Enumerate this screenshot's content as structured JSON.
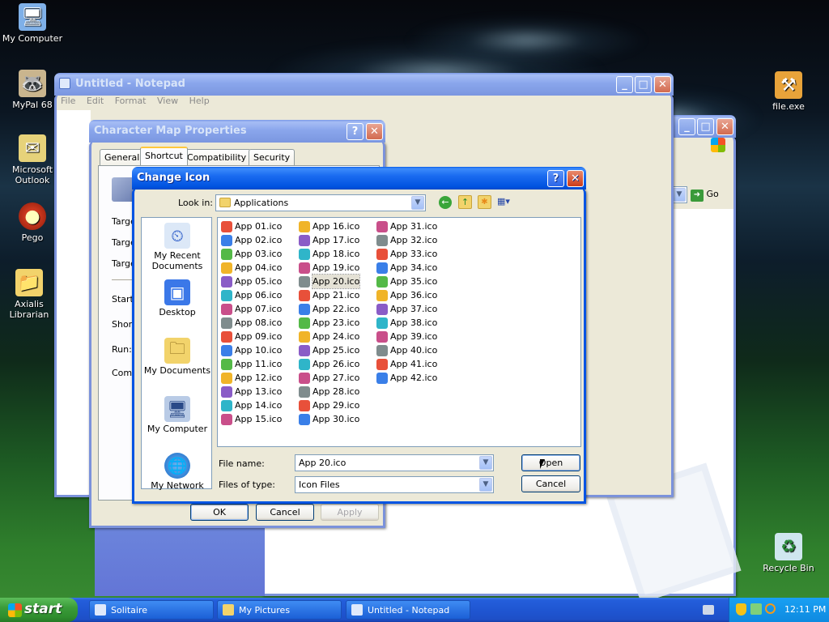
{
  "desktop": {
    "icons": [
      {
        "label": "My Computer",
        "glyph": "🖥"
      },
      {
        "label": "MyPal 68",
        "glyph": "🦝"
      },
      {
        "label": "Microsoft Outlook",
        "glyph": "✉"
      },
      {
        "label": "Pego",
        "glyph": "●"
      },
      {
        "label": "Axialis Librarian",
        "glyph": "📁"
      },
      {
        "label": "file.exe",
        "glyph": "⚒"
      },
      {
        "label": "Recycle Bin",
        "glyph": "♻"
      }
    ]
  },
  "notepad": {
    "title": "Untitled - Notepad",
    "menu": [
      "File",
      "Edit",
      "Format",
      "View",
      "Help"
    ]
  },
  "explorer": {
    "go_label": "Go"
  },
  "charmap": {
    "title": "Character Map Properties",
    "help": "?",
    "tabs": [
      "General",
      "Shortcut",
      "Compatibility",
      "Security"
    ],
    "fields": [
      "Target",
      "Target",
      "Target",
      "Start in",
      "Shortcut",
      "Run:",
      "Comment"
    ],
    "ok": "OK",
    "cancel": "Cancel",
    "apply": "Apply"
  },
  "dialog": {
    "title": "Change Icon",
    "help": "?",
    "look_in_label": "Look in:",
    "look_in_value": "Applications",
    "places": [
      "My Recent Documents",
      "Desktop",
      "My Documents",
      "My Computer",
      "My Network"
    ],
    "file_name_label": "File name:",
    "file_name_value": "App 20.ico",
    "file_type_label": "Files of type:",
    "file_type_value": "Icon Files",
    "open": "Open",
    "cancel": "Cancel",
    "selected": "App 20.ico",
    "files_col1": [
      "App 01.ico",
      "App 02.ico",
      "App 03.ico",
      "App 04.ico",
      "App 05.ico",
      "App 06.ico",
      "App 07.ico",
      "App 08.ico",
      "App 09.ico",
      "App 10.ico",
      "App 11.ico",
      "App 12.ico",
      "App 13.ico",
      "App 14.ico",
      "App 15.ico"
    ],
    "files_col2": [
      "App 16.ico",
      "App 17.ico",
      "App 18.ico",
      "App 19.ico",
      "App 20.ico",
      "App 21.ico",
      "App 22.ico",
      "App 23.ico",
      "App 24.ico",
      "App 25.ico",
      "App 26.ico",
      "App 27.ico",
      "App 28.ico",
      "App 29.ico",
      "App 30.ico"
    ],
    "files_col3": [
      "App 31.ico",
      "App 32.ico",
      "App 33.ico",
      "App 34.ico",
      "App 35.ico",
      "App 36.ico",
      "App 37.ico",
      "App 38.ico",
      "App 39.ico",
      "App 40.ico",
      "App 41.ico",
      "App 42.ico"
    ]
  },
  "taskbar": {
    "start": "start",
    "tasks": [
      "Solitaire",
      "My Pictures",
      "Untitled - Notepad"
    ],
    "clock": "12:11 PM"
  },
  "colors": {
    "xp_blue": "#0054e3",
    "icon_palette": [
      "#e8503a",
      "#3a7fe8",
      "#54b947",
      "#f0b429",
      "#8a5cc7",
      "#2fb5c9",
      "#c94f8a",
      "#7f8c8d"
    ]
  }
}
